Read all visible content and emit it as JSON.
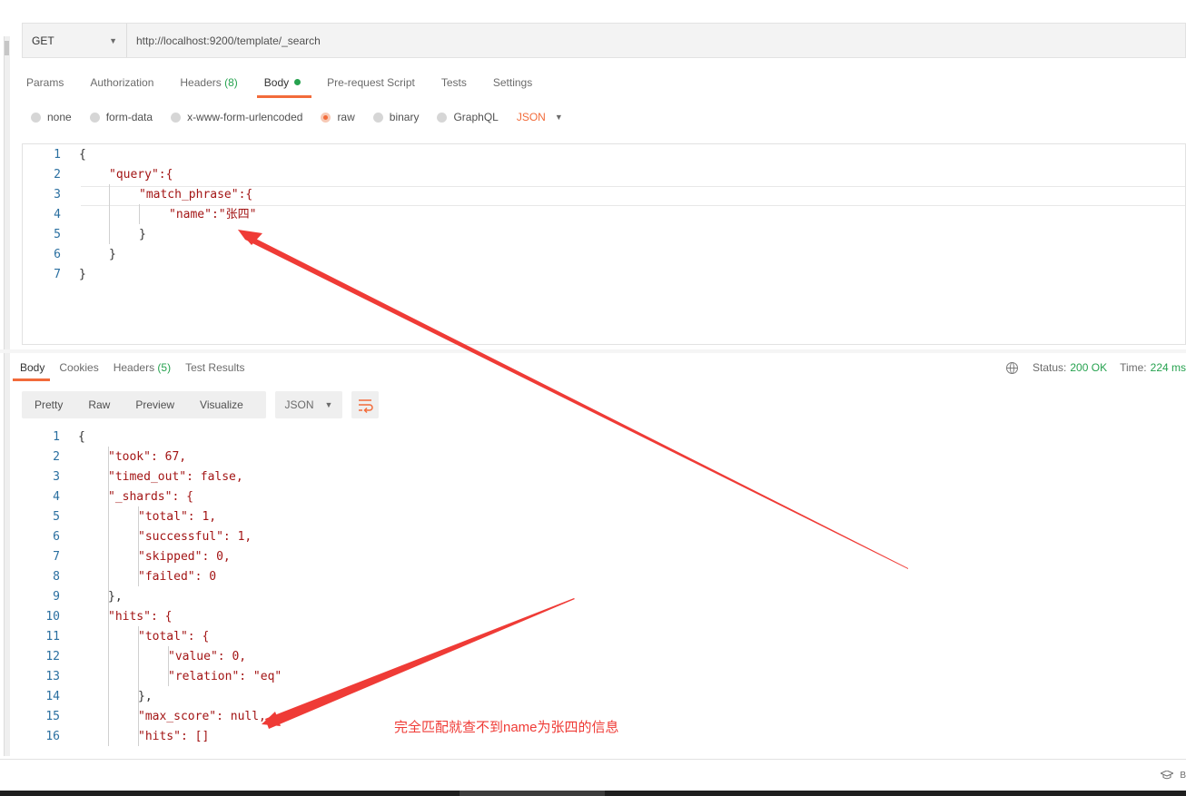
{
  "request": {
    "method": "GET",
    "url": "http://localhost:9200/template/_search"
  },
  "req_tabs": [
    {
      "label": "Params"
    },
    {
      "label": "Authorization"
    },
    {
      "label": "Headers",
      "badge": "(8)"
    },
    {
      "label": "Body"
    },
    {
      "label": "Pre-request Script"
    },
    {
      "label": "Tests"
    },
    {
      "label": "Settings"
    }
  ],
  "body_types": [
    "none",
    "form-data",
    "x-www-form-urlencoded",
    "raw",
    "binary",
    "GraphQL"
  ],
  "body_language": "JSON",
  "request_lines": [
    {
      "n": "1",
      "t": "{"
    },
    {
      "n": "2",
      "t": "\"query\":{"
    },
    {
      "n": "3",
      "t": "\"match_phrase\":{"
    },
    {
      "n": "4",
      "t": "\"name\":\"张四\""
    },
    {
      "n": "5",
      "t": "}"
    },
    {
      "n": "6",
      "t": "}"
    },
    {
      "n": "7",
      "t": "}"
    }
  ],
  "resp_tabs": [
    {
      "label": "Body"
    },
    {
      "label": "Cookies"
    },
    {
      "label": "Headers",
      "badge": "(5)"
    },
    {
      "label": "Test Results"
    }
  ],
  "status": {
    "status_label": "Status:",
    "status_value": "200 OK",
    "time_label": "Time:",
    "time_value": "224 ms"
  },
  "view_modes": [
    "Pretty",
    "Raw",
    "Preview",
    "Visualize"
  ],
  "response_format": "JSON",
  "response_lines": [
    {
      "n": "1",
      "t": "{"
    },
    {
      "n": "2",
      "t": "\"took\": 67,"
    },
    {
      "n": "3",
      "t": "\"timed_out\": false,"
    },
    {
      "n": "4",
      "t": "\"_shards\": {"
    },
    {
      "n": "5",
      "t": "\"total\": 1,"
    },
    {
      "n": "6",
      "t": "\"successful\": 1,"
    },
    {
      "n": "7",
      "t": "\"skipped\": 0,"
    },
    {
      "n": "8",
      "t": "\"failed\": 0"
    },
    {
      "n": "9",
      "t": "},"
    },
    {
      "n": "10",
      "t": "\"hits\": {"
    },
    {
      "n": "11",
      "t": "\"total\": {"
    },
    {
      "n": "12",
      "t": "\"value\": 0,"
    },
    {
      "n": "13",
      "t": "\"relation\": \"eq\""
    },
    {
      "n": "14",
      "t": "},"
    },
    {
      "n": "15",
      "t": "\"max_score\": null,"
    },
    {
      "n": "16",
      "t": "\"hits\": []"
    }
  ],
  "annotation": "完全匹配就查不到name为张四的信息",
  "colors": {
    "accent": "#f26b3a",
    "success": "#26a24f",
    "arrow": "#ef3b36"
  },
  "icons": {
    "globe": "globe-icon",
    "wrap": "wrap-lines-icon",
    "bootcamp": "graduation-cap-icon"
  },
  "footer_glyph": "B"
}
